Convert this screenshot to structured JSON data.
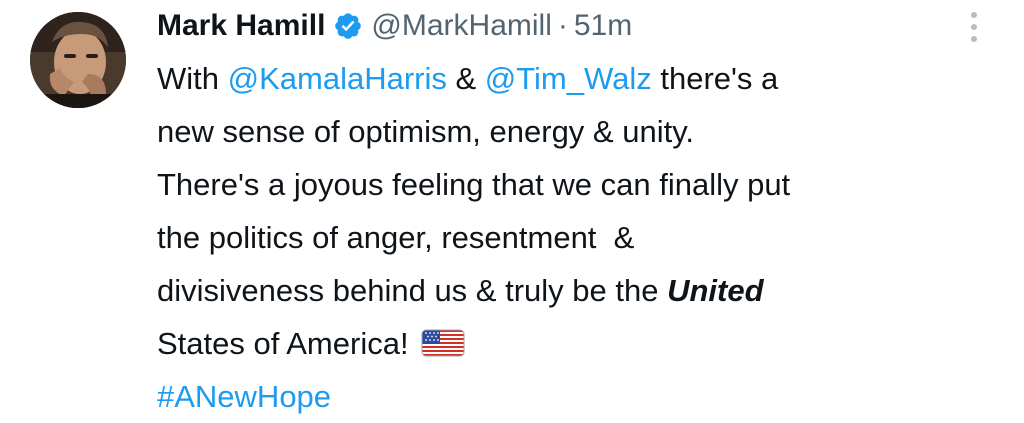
{
  "author": {
    "name": "Mark Hamill",
    "handle": "@MarkHamill",
    "separator": "·",
    "time": "51m",
    "verified": true
  },
  "tweet": {
    "line1": {
      "prefix": "With ",
      "mention1": "@KamalaHarris",
      "and": " & ",
      "mention2": "@Tim_Walz",
      "suffix": " there's a"
    },
    "line2": "new sense of optimism, energy & unity.",
    "line3": "There's a joyous feeling that we can finally put",
    "line4": "the politics of anger, resentment  &",
    "line5": {
      "text": "divisiveness behind us & truly be the ",
      "emphasis": "United"
    },
    "line6": "States of America!",
    "flag_emoji": "us-flag",
    "hashtag": "#ANewHope"
  },
  "icons": {
    "verified": "verified-badge-icon",
    "more": "more-options-icon"
  },
  "colors": {
    "text": "#0f1419",
    "secondary": "#536471",
    "link": "#1d9bf0",
    "verified": "#1d9bf0"
  }
}
